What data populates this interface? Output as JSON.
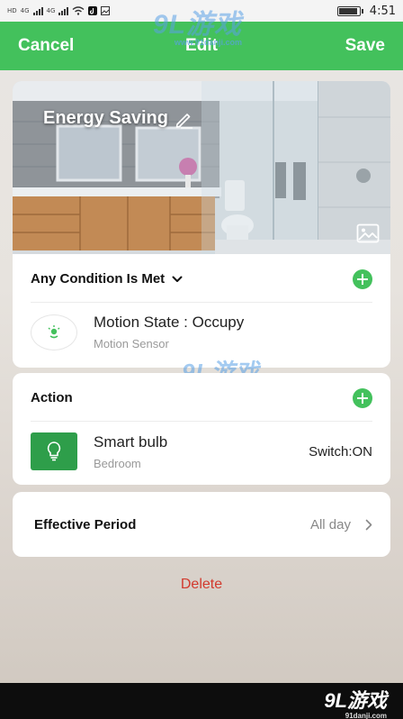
{
  "status_bar": {
    "network_labels": [
      "HD",
      "4G",
      "4G"
    ],
    "time": "4:51"
  },
  "header": {
    "cancel_label": "Cancel",
    "title": "Edit",
    "save_label": "Save"
  },
  "watermark": {
    "logo_text": "9L游戏",
    "domain": "www.91danji.com",
    "domain_short": "91danji.com"
  },
  "scene": {
    "name": "Energy Saving"
  },
  "conditions": {
    "title": "Any Condition Is Met",
    "items": [
      {
        "name": "Motion State : Occupy",
        "device": "Motion Sensor"
      }
    ]
  },
  "actions": {
    "title": "Action",
    "items": [
      {
        "name": "Smart bulb",
        "room": "Bedroom",
        "value": "Switch:ON"
      }
    ]
  },
  "effective_period": {
    "label": "Effective Period",
    "value": "All day"
  },
  "delete_label": "Delete",
  "colors": {
    "accent": "#43c15c",
    "bulb_tile": "#2e9e4a",
    "delete": "#d23a2e"
  }
}
